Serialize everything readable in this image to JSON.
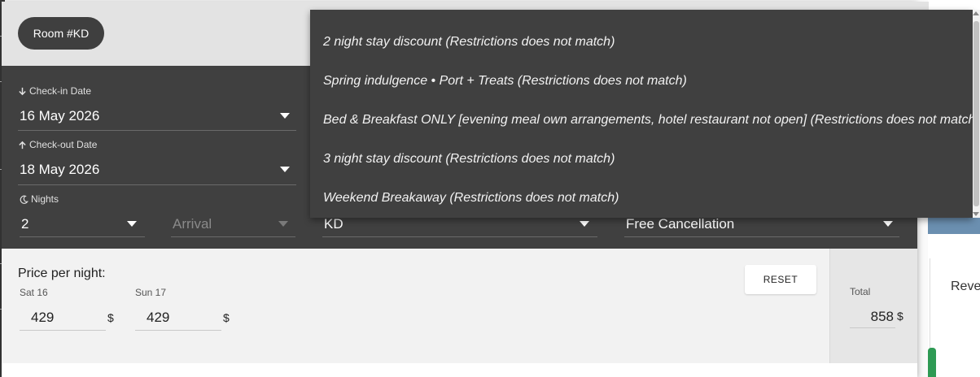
{
  "room_chip": "Room #KD",
  "checkin": {
    "label": "Check-in Date",
    "value": "16 May 2026"
  },
  "checkout": {
    "label": "Check-out Date",
    "value": "18 May 2026"
  },
  "nights": {
    "label": "Nights",
    "value": "2"
  },
  "arrival": {
    "placeholder": "Arrival"
  },
  "room_select": {
    "value": "KD"
  },
  "cancellation": {
    "value": "Free Cancellation"
  },
  "pricing": {
    "title": "Price per night:",
    "reset_label": "RESET",
    "nights": [
      {
        "day": "Sat 16",
        "price": "429",
        "currency": "$"
      },
      {
        "day": "Sun 17",
        "price": "429",
        "currency": "$"
      }
    ],
    "total_label": "Total",
    "total_value": "858",
    "total_currency": "$"
  },
  "rate_menu": {
    "items": [
      "2 night stay discount (Restrictions does not match)",
      "Spring indulgence • Port + Treats (Restrictions does not match)",
      "Bed & Breakfast ONLY [evening meal own arrangements, hotel restaurant not open] (Restrictions does not match)",
      "3 night stay discount (Restrictions does not match)",
      "Weekend Breakaway (Restrictions does not match)"
    ]
  },
  "background": {
    "card_title": "Reve"
  },
  "colors": {
    "dialog_dark": "#404040",
    "header_bg": "#e3e3e3",
    "price_bg": "#f2f2f2",
    "accent_green": "#2e9a54",
    "band_blue": "#6b8fb0"
  },
  "icons": {
    "checkin": "arrow-down-icon",
    "checkout": "arrow-up-icon",
    "nights": "moon-icon",
    "dropdown": "caret-down-icon"
  }
}
